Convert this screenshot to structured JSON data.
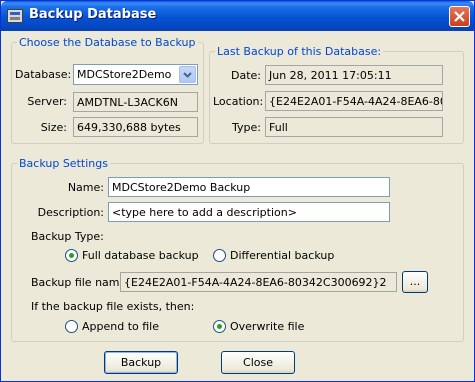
{
  "window": {
    "title": "Backup Database"
  },
  "database_group": {
    "legend": "Choose the Database to Backup",
    "database_label": "Database:",
    "database_value": "MDCStore2Demo",
    "server_label": "Server:",
    "server_value": "AMDTNL-L3ACK6N",
    "size_label": "Size:",
    "size_value": "649,330,688 bytes"
  },
  "last_backup_group": {
    "legend": "Last Backup of this Database:",
    "date_label": "Date:",
    "date_value": "Jun 28, 2011 17:05:11",
    "location_label": "Location:",
    "location_value": "{E24E2A01-F54A-4A24-8EA6-8034",
    "type_label": "Type:",
    "type_value": "Full"
  },
  "settings_group": {
    "legend": "Backup Settings",
    "name_label": "Name:",
    "name_value": "MDCStore2Demo Backup",
    "description_label": "Description:",
    "description_value": "<type here to add a description>",
    "backup_type_label": "Backup Type:",
    "full_label": "Full database backup",
    "differential_label": "Differential backup",
    "backup_type_selected": "full",
    "file_name_label": "Backup file name:",
    "file_name_value": "{E24E2A01-F54A-4A24-8EA6-80342C300692}2",
    "browse_label": "...",
    "exists_label": "If the backup file exists, then:",
    "append_label": "Append to file",
    "overwrite_label": "Overwrite file",
    "exists_selected": "overwrite"
  },
  "buttons": {
    "backup_label": "Backup",
    "close_label": "Close"
  },
  "icons": {
    "title_icon": "database-icon",
    "close_icon": "close-icon",
    "dropdown_icon": "chevron-down-icon"
  },
  "colors": {
    "title_bar": "#0553d3",
    "group_legend": "#0046d5",
    "dialog_background": "#ece9d8"
  }
}
